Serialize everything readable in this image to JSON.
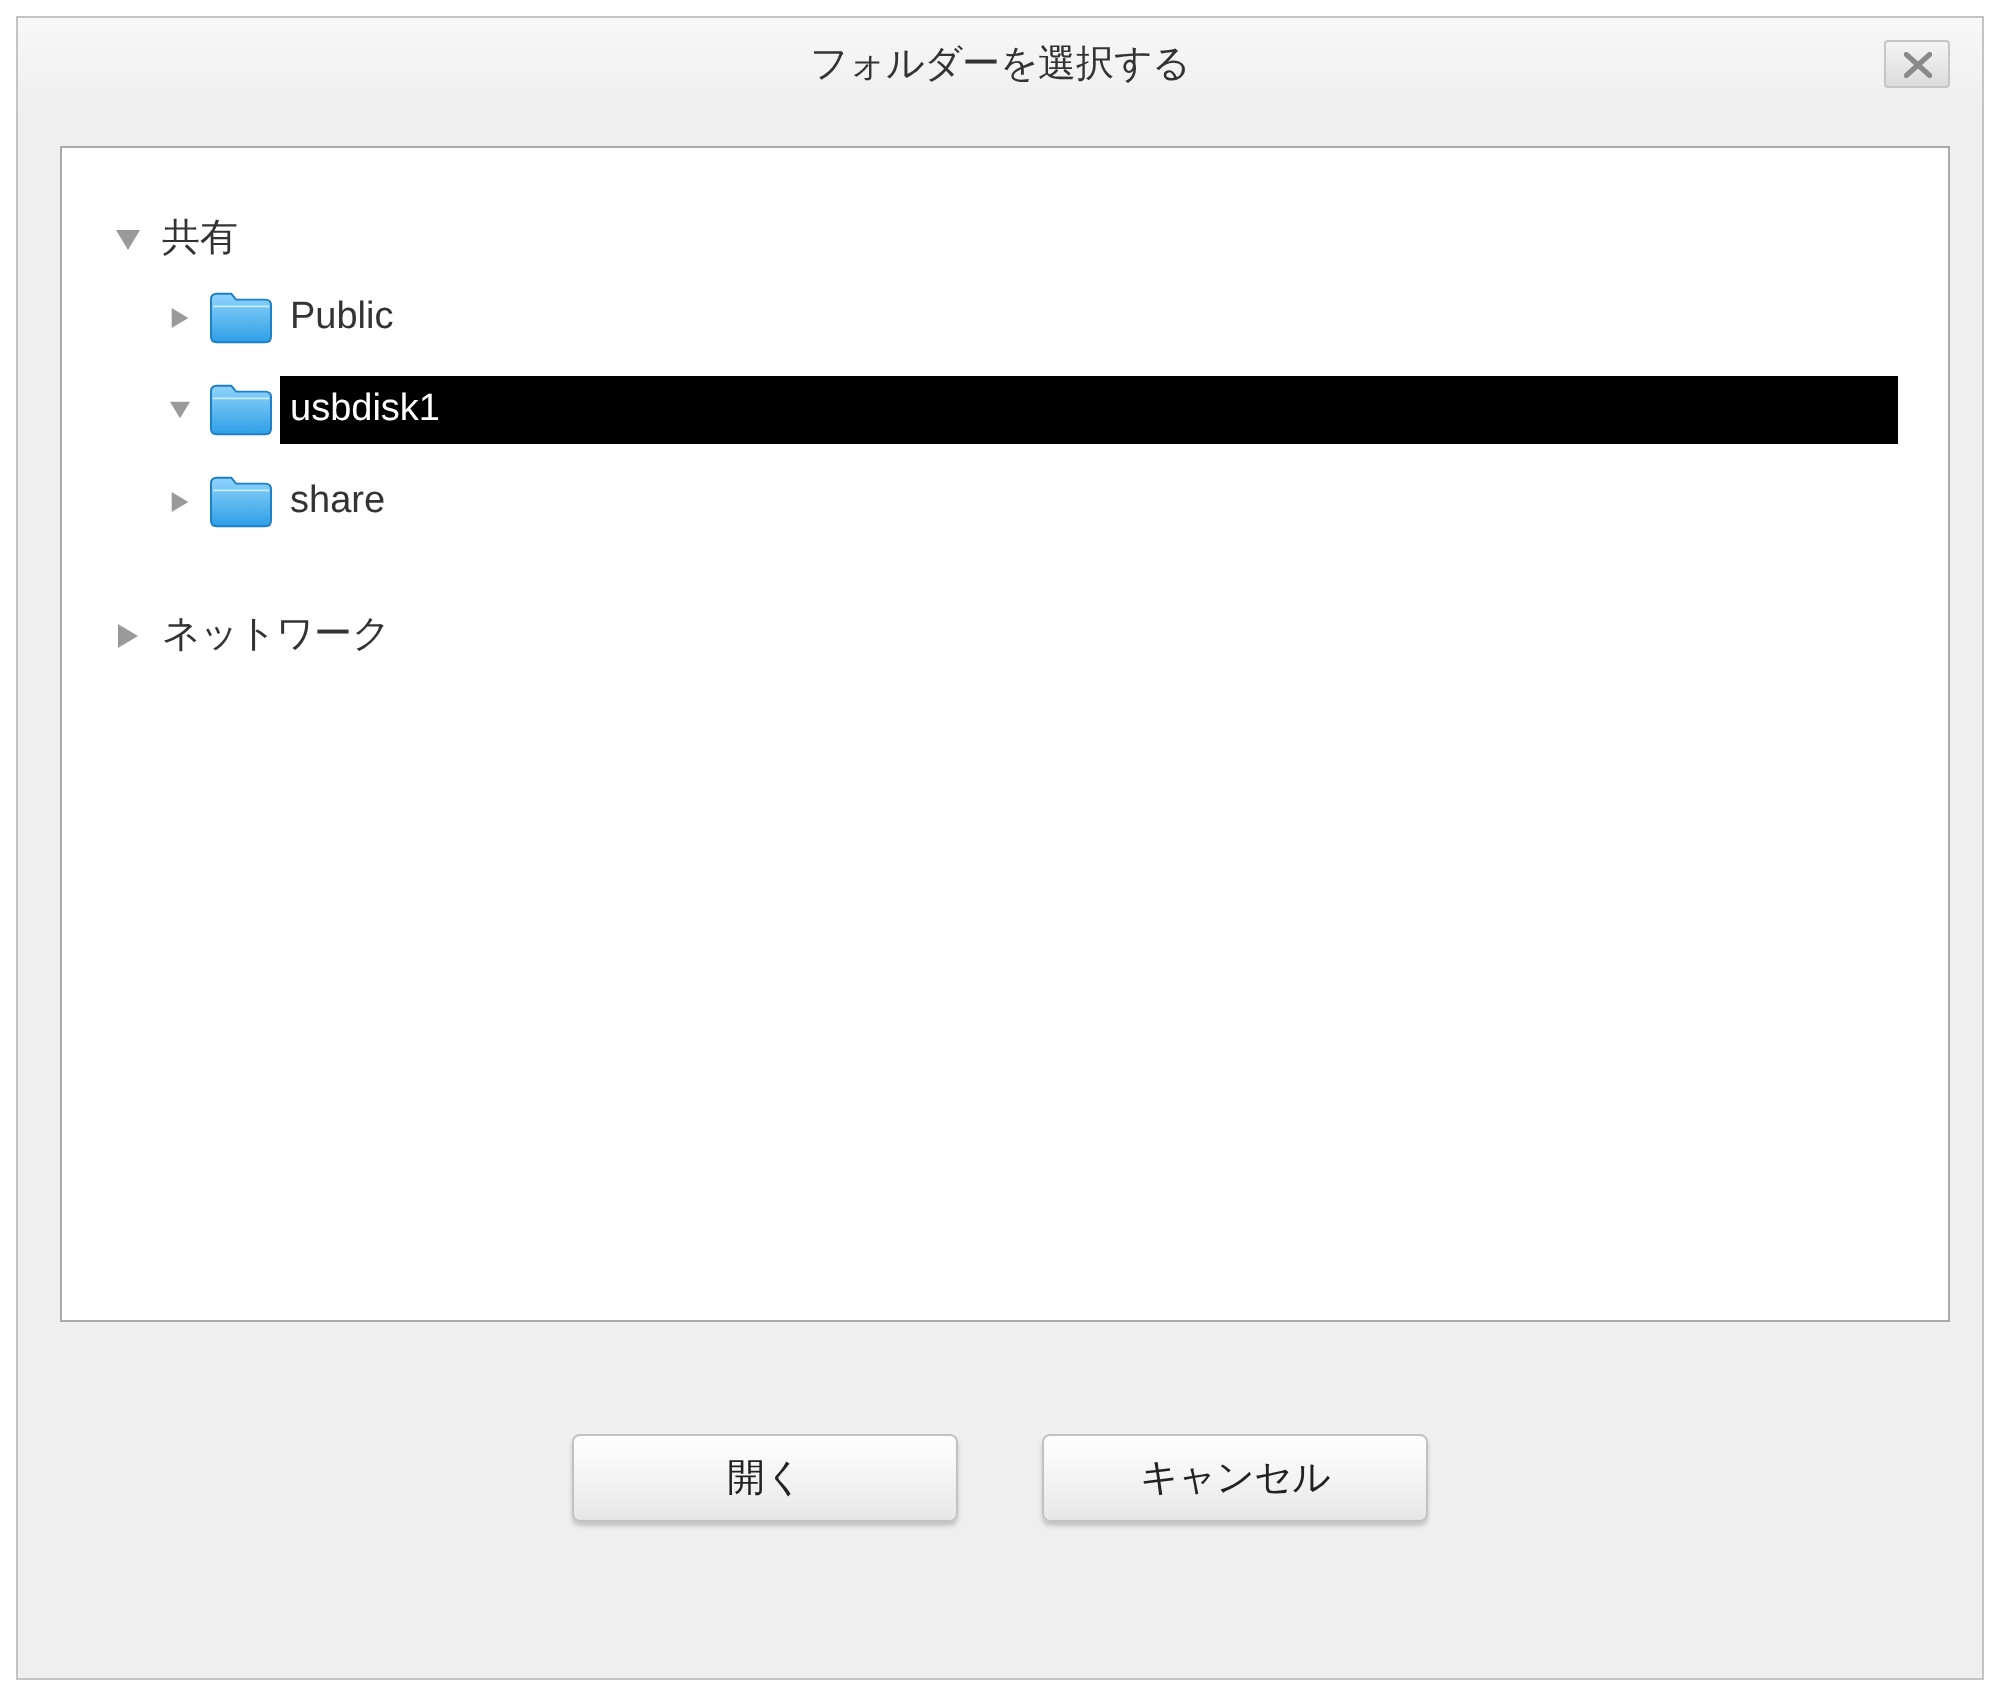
{
  "window": {
    "title": "フォルダーを選択する"
  },
  "tree": [
    {
      "label": "共有",
      "expanded": true,
      "selected": false,
      "children": [
        {
          "label": "Public",
          "expanded": false,
          "selected": false
        },
        {
          "label": "usbdisk1",
          "expanded": true,
          "selected": true
        },
        {
          "label": "share",
          "expanded": false,
          "selected": false
        }
      ]
    },
    {
      "label": "ネットワーク",
      "expanded": false,
      "selected": false
    }
  ],
  "buttons": [
    "開く",
    "キャンセル"
  ]
}
